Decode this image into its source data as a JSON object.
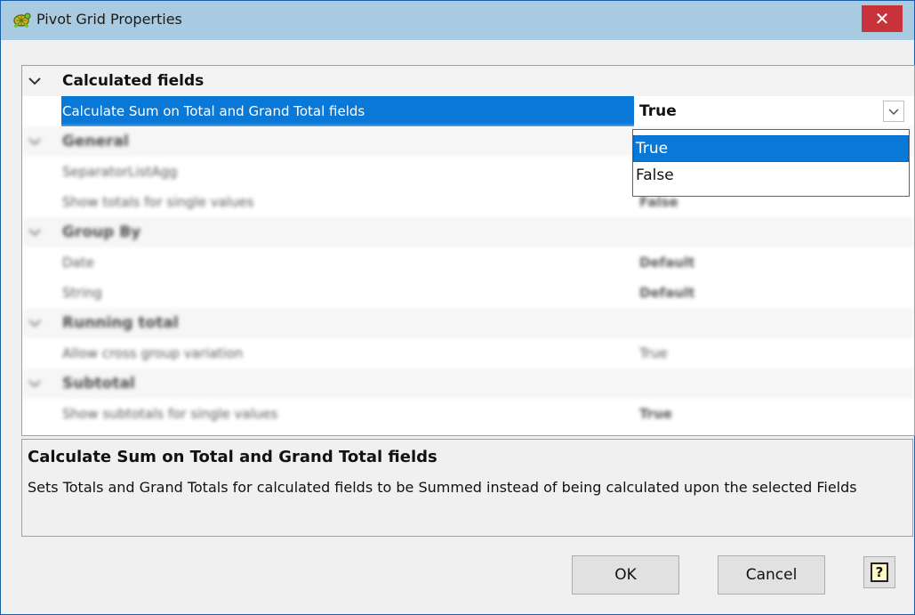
{
  "window": {
    "title": "Pivot Grid Properties",
    "close_label": "✕"
  },
  "grid": {
    "rows": [
      {
        "kind": "category",
        "label": "Calculated fields"
      },
      {
        "kind": "property",
        "label": "Calculate Sum on Total and Grand Total fields",
        "value": "True",
        "selected": true
      },
      {
        "kind": "category",
        "label": "General"
      },
      {
        "kind": "property",
        "label": "SeparatorListAgg",
        "value": ""
      },
      {
        "kind": "property",
        "label": "Show totals for single values",
        "value": "False"
      },
      {
        "kind": "category",
        "label": "Group By"
      },
      {
        "kind": "property",
        "label": "Date",
        "value": "Default"
      },
      {
        "kind": "property",
        "label": "String",
        "value": "Default"
      },
      {
        "kind": "category",
        "label": "Running total"
      },
      {
        "kind": "property",
        "label": "Allow cross group variation",
        "value": "True"
      },
      {
        "kind": "category",
        "label": "Subtotal"
      },
      {
        "kind": "property",
        "label": "Show subtotals for single values",
        "value": "True"
      }
    ]
  },
  "dropdown": {
    "options": [
      "True",
      "False"
    ],
    "selected": "True"
  },
  "description": {
    "title": "Calculate Sum on Total and Grand Total fields",
    "text": "Sets Totals and Grand Totals for calculated fields to be Summed instead of being calculated upon the selected Fields"
  },
  "buttons": {
    "ok": "OK",
    "cancel": "Cancel",
    "help": "?"
  },
  "colors": {
    "titlebar": "#a9cbe2",
    "selection": "#0a78d7",
    "close": "#c8323a"
  },
  "icons": [
    "app-turtle-icon",
    "close-icon",
    "chevron-down-icon",
    "combo-arrow-icon",
    "help-icon"
  ]
}
